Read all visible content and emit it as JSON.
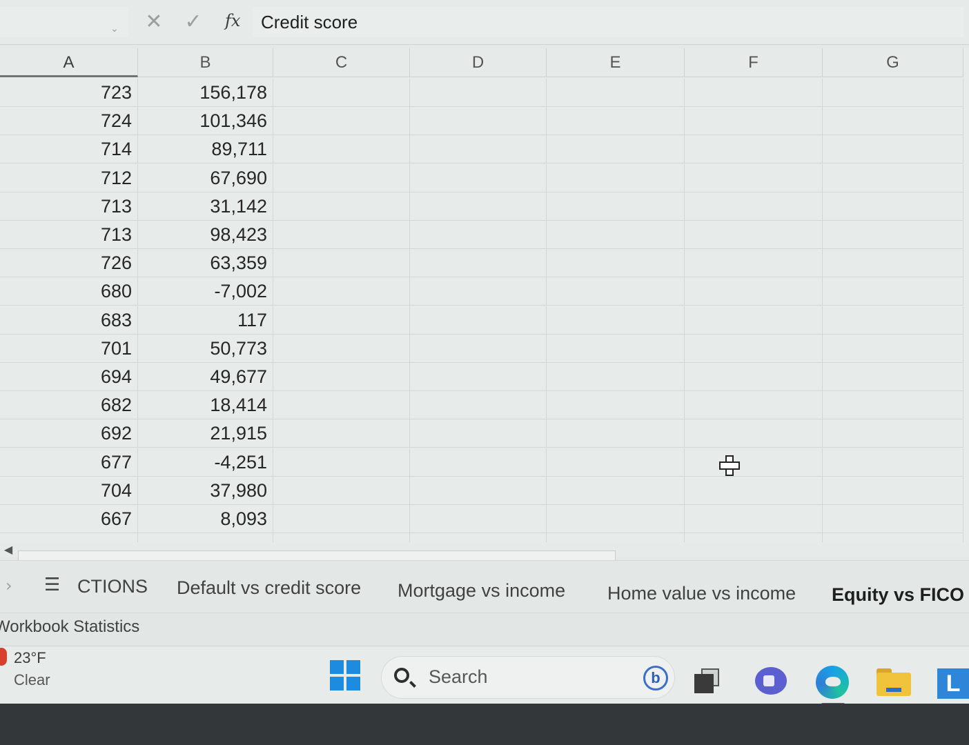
{
  "formula_bar": {
    "fx": "fx",
    "content": "Credit score"
  },
  "grid": {
    "columns": [
      "A",
      "B",
      "C",
      "D",
      "E",
      "F",
      "G"
    ],
    "selected_column": "A",
    "rows": [
      [
        "723",
        "156,178"
      ],
      [
        "724",
        "101,346"
      ],
      [
        "714",
        "89,711"
      ],
      [
        "712",
        "67,690"
      ],
      [
        "713",
        "31,142"
      ],
      [
        "713",
        "98,423"
      ],
      [
        "726",
        "63,359"
      ],
      [
        "680",
        "-7,002"
      ],
      [
        "683",
        "117"
      ],
      [
        "701",
        "50,773"
      ],
      [
        "694",
        "49,677"
      ],
      [
        "682",
        "18,414"
      ],
      [
        "692",
        "21,915"
      ],
      [
        "677",
        "-4,251"
      ],
      [
        "704",
        "37,980"
      ],
      [
        "667",
        "8,093"
      ]
    ]
  },
  "sheet_tabs": {
    "menu_label": "CTIONS",
    "tabs": [
      "Default vs credit score",
      "Mortgage vs income",
      "Home value vs income",
      "Equity vs FICO"
    ],
    "active_tab": "Equity vs FICO"
  },
  "status_bar": {
    "text": "Workbook Statistics"
  },
  "taskbar": {
    "weather_temp": "23°F",
    "weather_condition": "Clear",
    "search_label": "Search",
    "app_letter": "L",
    "icons": [
      "windows-start-icon",
      "search-icon",
      "bing-icon",
      "task-view-icon",
      "teams-icon",
      "edge-icon",
      "file-explorer-icon",
      "l-app-icon"
    ]
  }
}
